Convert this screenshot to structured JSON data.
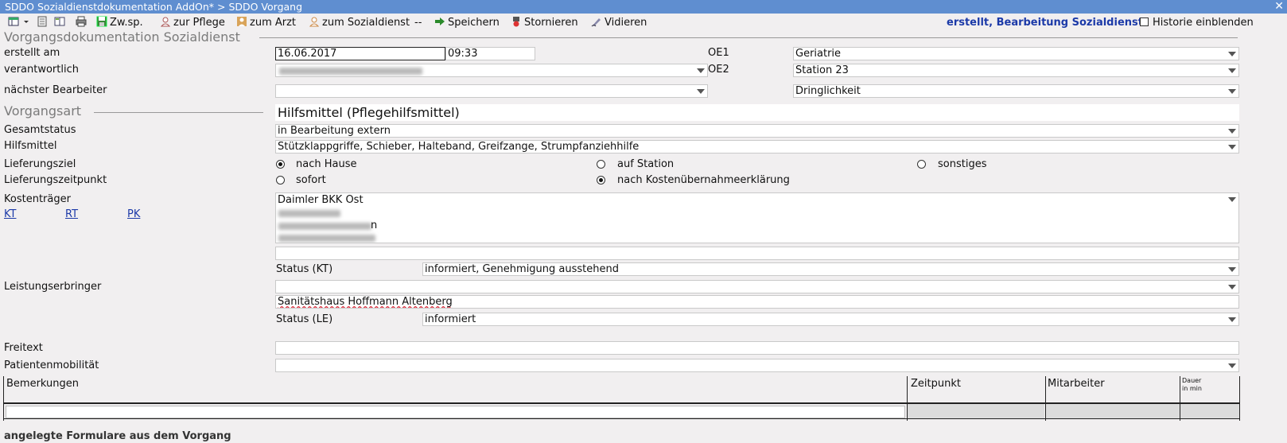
{
  "window": {
    "title": "SDDO Sozialdienstdokumentation AddOn* > SDDO Vorgang",
    "close": "✕"
  },
  "toolbar": {
    "zwsp": "Zw.sp.",
    "zur_pflege": "zur Pflege",
    "zum_arzt": "zum Arzt",
    "zum_sozialdienst": "zum Sozialdienst",
    "separator": "--",
    "speichern": "Speichern",
    "stornieren": "Stornieren",
    "vidieren": "Vidieren",
    "status": "erstellt, Bearbeitung Sozialdienst",
    "historie": "Historie einblenden"
  },
  "form": {
    "section_title": "Vorgangsdokumentation Sozialdienst",
    "erstellt_label": "erstellt am",
    "erstellt_date": "16.06.2017",
    "erstellt_time": "09:33",
    "oe1_label": "OE1",
    "oe1_value": "Geriatrie",
    "verantwortlich_label": "verantwortlich",
    "oe2_label": "OE2",
    "oe2_value": "Station 23",
    "naechster_label": "nächster Bearbeiter",
    "naechster_value": "",
    "dringlichkeit_value": "Dringlichkeit",
    "vorgangsart_section": "Vorgangsart",
    "vorgangsart_value": "Hilfsmittel (Pflegehilfsmittel)",
    "gesamtstatus_label": "Gesamtstatus",
    "gesamtstatus_value": "in Bearbeitung extern",
    "hilfsmittel_label": "Hilfsmittel",
    "hilfsmittel_value": "Stützklappgriffe, Schieber, Halteband, Greifzange, Strumpfanziehhilfe",
    "lieferungsziel_label": "Lieferungsziel",
    "ziel_options": [
      "nach Hause",
      "auf Station",
      "sonstiges"
    ],
    "ziel_selected": "nach Hause",
    "lieferungszeitpunkt_label": "Lieferungszeitpunkt",
    "zeitpunkt_options": [
      "sofort",
      "nach Kostenübernahmeerklärung"
    ],
    "zeitpunkt_selected": "nach Kostenübernahmeerklärung",
    "kostentraeger_label": "Kostenträger",
    "kostentraeger_name": "Daimler BKK Ost",
    "kostentraeger_partial": "n",
    "links": [
      "KT",
      "RT",
      "PK"
    ],
    "status_kt_label": "Status (KT)",
    "status_kt_value": "informiert, Genehmigung ausstehend",
    "leistungserbringer_label": "Leistungserbringer",
    "leistungserbringer_value": "",
    "leistungserbringer_name": "Sanitätshaus Hoffmann Altenberg",
    "status_le_label": "Status (LE)",
    "status_le_value": "informiert",
    "freitext_label": "Freitext",
    "freitext_value": "",
    "mobilitaet_label": "Patientenmobilität",
    "mobilitaet_value": ""
  },
  "table": {
    "headers": [
      "Bemerkungen",
      "Zeitpunkt",
      "Mitarbeiter"
    ],
    "dauer_line1": "Dauer",
    "dauer_line2": "in min"
  },
  "footer_text": "angelegte Formulare aus dem Vorgang"
}
